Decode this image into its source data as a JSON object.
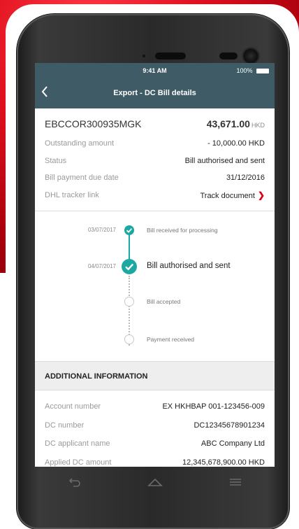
{
  "status_bar": {
    "time": "9:41 AM",
    "battery": "100%"
  },
  "header": {
    "title": "Export - DC Bill details"
  },
  "summary": {
    "reference": "EBCCOR300935MGK",
    "amount": "43,671.00",
    "currency": "HKD",
    "rows": [
      {
        "label": "Outstanding amount",
        "value": "- 10,000.00 HKD"
      },
      {
        "label": "Status",
        "value": "Bill authorised and sent"
      },
      {
        "label": "Bill payment due date",
        "value": "31/12/2016"
      }
    ],
    "tracker": {
      "label": "DHL tracker link",
      "value": "Track document"
    }
  },
  "timeline": [
    {
      "date": "03/07/2017",
      "label": "Bill received for processing",
      "state": "done"
    },
    {
      "date": "04/07/2017",
      "label": "Bill authorised and sent",
      "state": "current"
    },
    {
      "date": "",
      "label": "Bill accepted",
      "state": "pending"
    },
    {
      "date": "",
      "label": "Payment received",
      "state": "pending"
    }
  ],
  "additional": {
    "heading": "ADDITIONAL INFORMATION",
    "rows": [
      {
        "label": "Account number",
        "value": "EX HKHBAP 001-123456-009"
      },
      {
        "label": "DC number",
        "value": "DC12345678901234"
      },
      {
        "label": "DC applicant name",
        "value": "ABC Company Ltd"
      },
      {
        "label": "Applied DC amount",
        "value": "12,345,678,900.00 HKD"
      }
    ]
  },
  "icons": {
    "back": "chevron-left-icon",
    "link": "chevron-right-icon",
    "softkeys": [
      "back-arrow-icon",
      "home-icon",
      "menu-icon"
    ]
  },
  "colors": {
    "header_bg": "#3e5b66",
    "accent_teal": "#1ba8a3",
    "link_red": "#d8001c",
    "background_red": "#e0101e"
  }
}
